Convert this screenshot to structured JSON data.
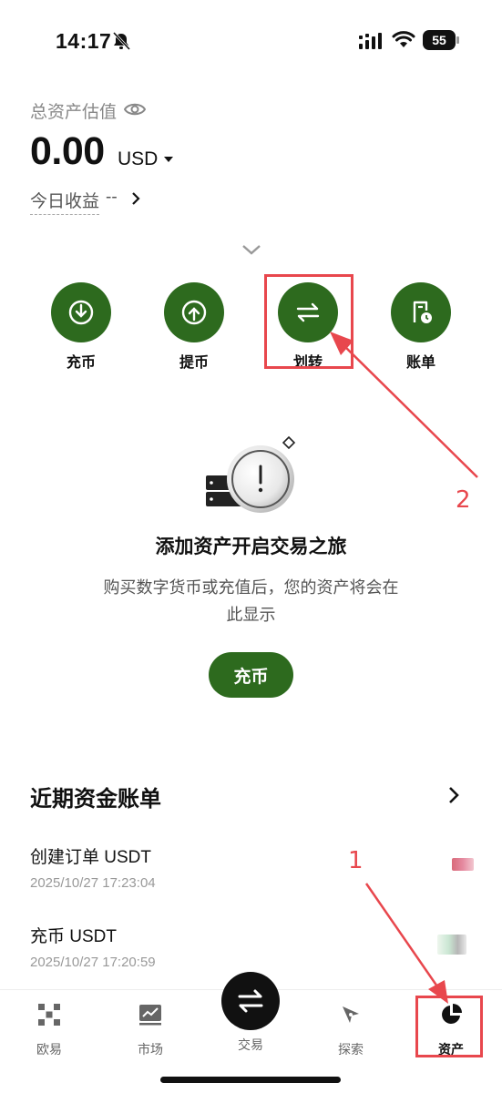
{
  "status_bar": {
    "time": "14:17",
    "battery": "55"
  },
  "header": {
    "total_label": "总资产估值",
    "balance": "0.00",
    "currency": "USD",
    "today_earnings_label": "今日收益",
    "today_earnings_value": "--"
  },
  "actions": [
    {
      "label": "充币",
      "icon": "deposit-icon"
    },
    {
      "label": "提币",
      "icon": "withdraw-icon"
    },
    {
      "label": "划转",
      "icon": "transfer-icon"
    },
    {
      "label": "账单",
      "icon": "bill-icon"
    }
  ],
  "empty_state": {
    "title": "添加资产开启交易之旅",
    "description": "购买数字货币或充值后，您的资产将会在此显示",
    "button": "充币"
  },
  "recent_bills": {
    "title": "近期资金账单",
    "items": [
      {
        "name": "创建订单 USDT",
        "time": "2025/10/27 17:23:04"
      },
      {
        "name": "充币 USDT",
        "time": "2025/10/27 17:20:59"
      }
    ]
  },
  "tabbar": [
    {
      "label": "欧易",
      "icon": "okx-logo-icon"
    },
    {
      "label": "市场",
      "icon": "market-chart-icon"
    },
    {
      "label": "交易",
      "icon": "trade-swap-icon"
    },
    {
      "label": "探索",
      "icon": "explore-compass-icon"
    },
    {
      "label": "资产",
      "icon": "assets-pie-icon"
    }
  ],
  "annotations": {
    "label_1": "1",
    "label_2": "2",
    "color": "#e8474d"
  },
  "colors": {
    "accent": "#2d6a1e",
    "text": "#111111",
    "muted": "#888888"
  }
}
